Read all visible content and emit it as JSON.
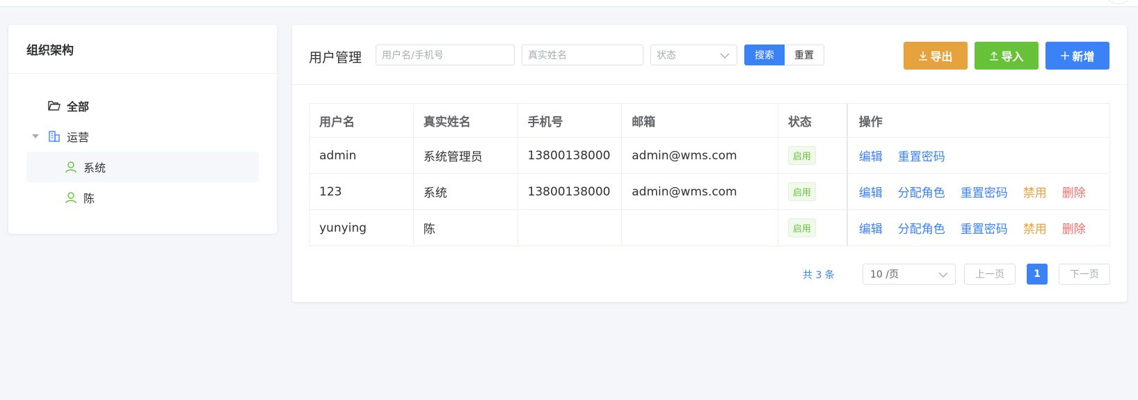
{
  "org": {
    "title": "组织架构",
    "tree": [
      {
        "label": "全部",
        "icon": "folder-icon"
      },
      {
        "label": "运营",
        "icon": "building-icon"
      },
      {
        "label": "系统",
        "icon": "user-icon"
      },
      {
        "label": "陈",
        "icon": "user-icon"
      }
    ]
  },
  "toolbar": {
    "title": "用户管理",
    "username_placeholder": "用户名/手机号",
    "realname_placeholder": "真实姓名",
    "status_placeholder": "状态",
    "search_label": "搜索",
    "reset_label": "重置",
    "export_label": "导出",
    "import_label": "导入",
    "add_label": "新增"
  },
  "table": {
    "headers": [
      "用户名",
      "真实姓名",
      "手机号",
      "邮箱",
      "状态",
      "操作"
    ],
    "rows": [
      {
        "username": "admin",
        "realname": "系统管理员",
        "phone": "13800138000",
        "email": "admin@wms.com",
        "status": "启用",
        "actions": {
          "edit": "编辑",
          "reset_pwd": "重置密码"
        }
      },
      {
        "username": "123",
        "realname": "系统",
        "phone": "13800138000",
        "email": "admin@wms.com",
        "status": "启用",
        "actions": {
          "edit": "编辑",
          "assign_role": "分配角色",
          "reset_pwd": "重置密码",
          "disable": "禁用",
          "delete": "删除"
        }
      },
      {
        "username": "yunying",
        "realname": "陈",
        "phone": "",
        "email": "",
        "status": "启用",
        "actions": {
          "edit": "编辑",
          "assign_role": "分配角色",
          "reset_pwd": "重置密码",
          "disable": "禁用",
          "delete": "删除"
        }
      }
    ]
  },
  "pager": {
    "total": "共 3 条",
    "page_size": "10 /页",
    "prev": "上一页",
    "current": "1",
    "next": "下一页"
  },
  "colors": {
    "primary": "#3b82f6",
    "export": "#e6a23c",
    "import": "#67c23a",
    "success": "#67c23a",
    "danger": "#f56c6c"
  }
}
